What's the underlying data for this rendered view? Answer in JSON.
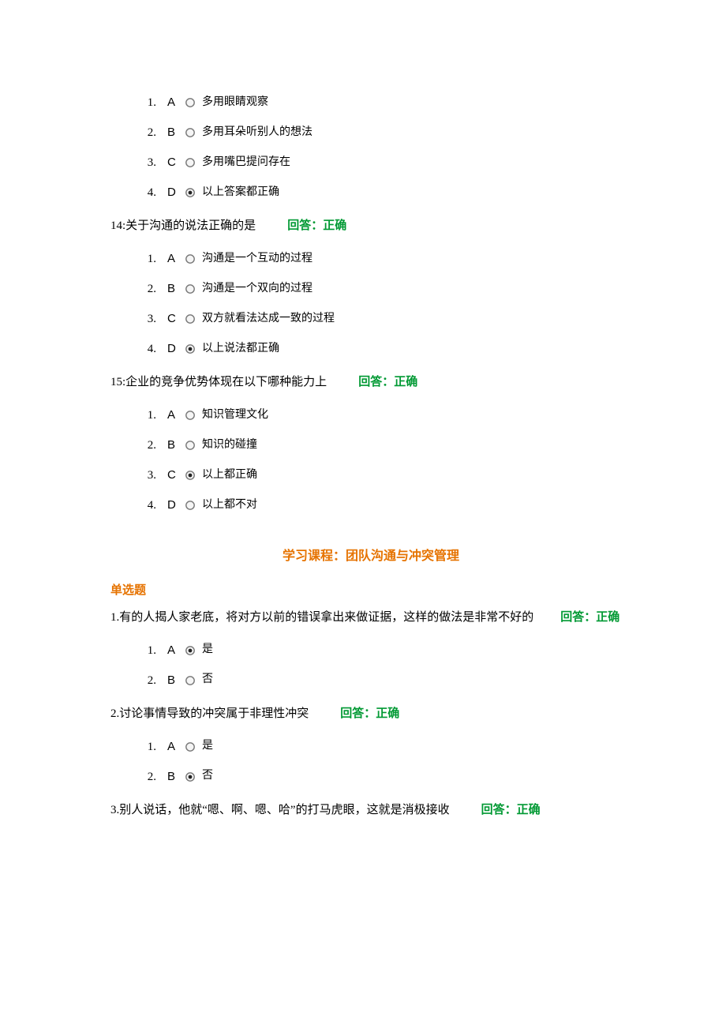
{
  "q13": {
    "options": [
      {
        "num": "1.",
        "letter": "A",
        "selected": false,
        "text": "多用眼睛观察"
      },
      {
        "num": "2.",
        "letter": "B",
        "selected": false,
        "text": "多用耳朵听别人的想法"
      },
      {
        "num": "3.",
        "letter": "C",
        "selected": false,
        "text": "多用嘴巴提问存在"
      },
      {
        "num": "4.",
        "letter": "D",
        "selected": true,
        "text": "以上答案都正确"
      }
    ]
  },
  "q14": {
    "num": "14:",
    "text": "关于沟通的说法正确的是",
    "gap": "       ",
    "ans_label": "回答：",
    "ans_value": "正确",
    "options": [
      {
        "num": "1.",
        "letter": "A",
        "selected": false,
        "text": "沟通是一个互动的过程"
      },
      {
        "num": "2.",
        "letter": "B",
        "selected": false,
        "text": "沟通是一个双向的过程"
      },
      {
        "num": "3.",
        "letter": "C",
        "selected": false,
        "text": "双方就看法达成一致的过程"
      },
      {
        "num": "4.",
        "letter": "D",
        "selected": true,
        "text": "以上说法都正确"
      }
    ]
  },
  "q15": {
    "num": "15:",
    "text": "企业的竞争优势体现在以下哪种能力上",
    "gap": "       ",
    "ans_label": "回答：",
    "ans_value": "正确",
    "options": [
      {
        "num": "1.",
        "letter": "A",
        "selected": false,
        "text": "知识管理文化"
      },
      {
        "num": "2.",
        "letter": "B",
        "selected": false,
        "text": "知识的碰撞"
      },
      {
        "num": "3.",
        "letter": "C",
        "selected": true,
        "text": "以上都正确"
      },
      {
        "num": "4.",
        "letter": "D",
        "selected": false,
        "text": "以上都不对"
      }
    ]
  },
  "course_title": "学习课程：团队沟通与冲突管理",
  "section_label": "单选题",
  "s1": {
    "num": "1.",
    "text": "有的人揭人家老底，将对方以前的错误拿出来做证据，这样的做法是非常不好的",
    "gap": "      ",
    "ans_label": "回答：",
    "ans_value": "正确",
    "options": [
      {
        "num": "1.",
        "letter": "A",
        "selected": true,
        "text": "是"
      },
      {
        "num": "2.",
        "letter": "B",
        "selected": false,
        "text": "否"
      }
    ]
  },
  "s2": {
    "num": "2.",
    "text": "讨论事情导致的冲突属于非理性冲突",
    "gap": "       ",
    "ans_label": "回答：",
    "ans_value": "正确",
    "options": [
      {
        "num": "1.",
        "letter": "A",
        "selected": false,
        "text": "是"
      },
      {
        "num": "2.",
        "letter": "B",
        "selected": true,
        "text": "否"
      }
    ]
  },
  "s3": {
    "num": "3.",
    "text": "别人说话，他就“嗯、啊、嗯、哈”的打马虎眼，这就是消极接收",
    "gap": "       ",
    "ans_label": "回答：",
    "ans_value": "正确"
  }
}
